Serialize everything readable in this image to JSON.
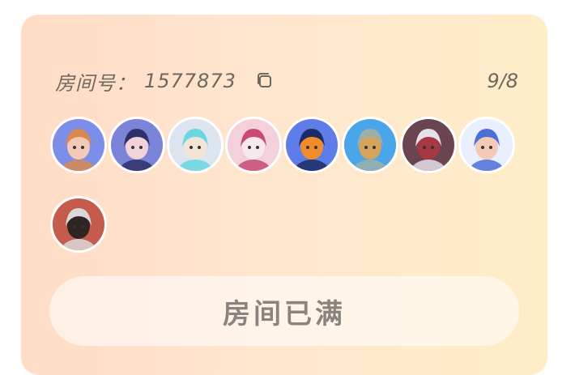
{
  "room": {
    "label": "房间号：",
    "number": "1577873",
    "count": "9/8",
    "copy_icon": "copy-icon"
  },
  "members": [
    {
      "name": "member-1",
      "colors": [
        "#7d8ee8",
        "#d9884f",
        "#f4c9b8"
      ]
    },
    {
      "name": "member-2",
      "colors": [
        "#7b84d8",
        "#2e2f66",
        "#f1d2d6"
      ]
    },
    {
      "name": "member-3",
      "colors": [
        "#dce4f0",
        "#67d7e0",
        "#f3e4d6"
      ]
    },
    {
      "name": "member-4",
      "colors": [
        "#f3d0da",
        "#c84a74",
        "#f6e8ee"
      ]
    },
    {
      "name": "member-5",
      "colors": [
        "#5f7de8",
        "#1b2b63",
        "#f08c2a"
      ]
    },
    {
      "name": "member-6",
      "colors": [
        "#4aa6e9",
        "#9cb0aa",
        "#d4a45d"
      ]
    },
    {
      "name": "member-7",
      "colors": [
        "#6b4452",
        "#e6e1e9",
        "#a63842"
      ]
    },
    {
      "name": "member-8",
      "colors": [
        "#e8efff",
        "#4b6fd6",
        "#f3c9b7"
      ]
    },
    {
      "name": "member-9",
      "colors": [
        "#c55b4d",
        "#d9d9d9",
        "#2f2523"
      ]
    }
  ],
  "action": {
    "full_label": "房间已满"
  },
  "colors": {
    "card_start": "#ffdcc6",
    "card_end": "#ffedc8",
    "text": "#6e6661",
    "button_text": "#8a8480"
  }
}
